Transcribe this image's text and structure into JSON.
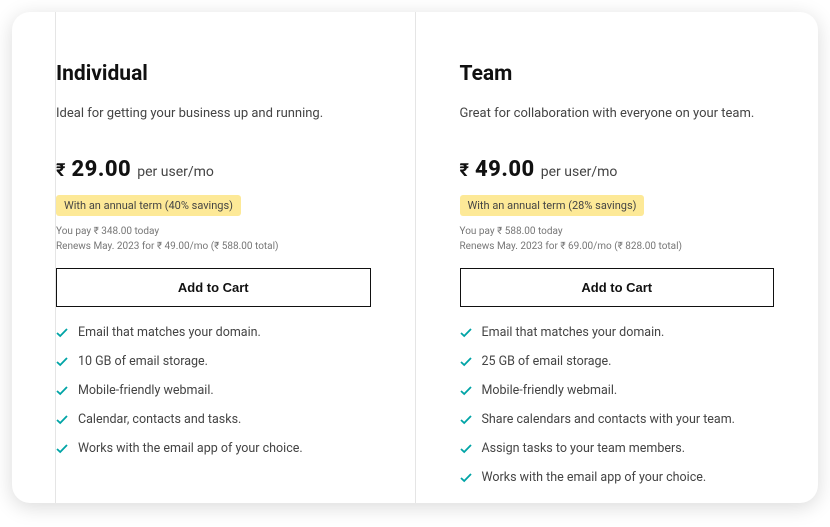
{
  "plans": [
    {
      "title": "Individual",
      "description": "Ideal for getting your business up and running.",
      "currency": "₹",
      "price": "29.00",
      "unit": "per user/mo",
      "savings_badge": "With an annual term (40% savings)",
      "pay_today": "You pay ₹ 348.00 today",
      "renews": "Renews May. 2023 for ₹ 49.00/mo (₹ 588.00 total)",
      "cta": "Add to Cart",
      "features": [
        "Email that matches your domain.",
        "10 GB of email storage.",
        "Mobile-friendly webmail.",
        "Calendar, contacts and tasks.",
        "Works with the email app of your choice."
      ]
    },
    {
      "title": "Team",
      "description": "Great for collaboration with everyone on your team.",
      "currency": "₹",
      "price": "49.00",
      "unit": "per user/mo",
      "savings_badge": "With an annual term (28% savings)",
      "pay_today": "You pay ₹ 588.00 today",
      "renews": "Renews May. 2023 for ₹ 69.00/mo (₹ 828.00 total)",
      "cta": "Add to Cart",
      "features": [
        "Email that matches your domain.",
        "25 GB of email storage.",
        "Mobile-friendly webmail.",
        "Share calendars and contacts with your team.",
        "Assign tasks to your team members.",
        "Works with the email app of your choice."
      ]
    }
  ],
  "colors": {
    "accent_check": "#00a4a6",
    "badge_bg": "#fde997"
  }
}
